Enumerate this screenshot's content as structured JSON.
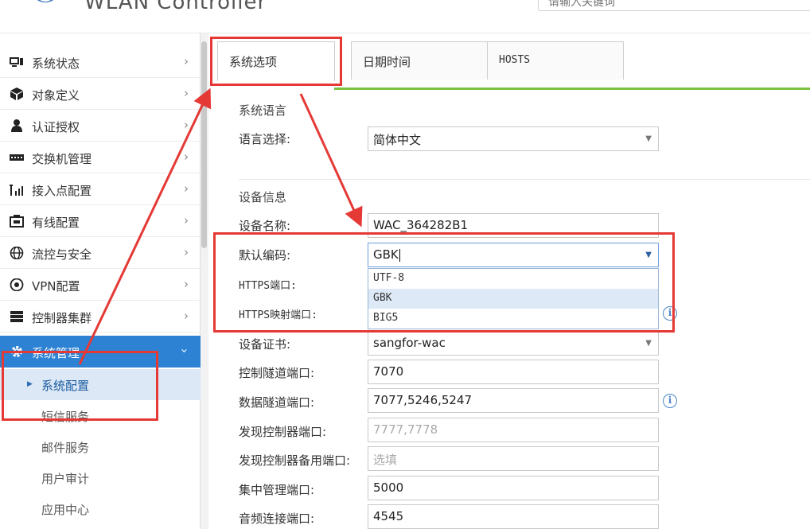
{
  "header": {
    "brand": "WLAN Controller",
    "search_placeholder": "请输入关键词"
  },
  "sidebar": {
    "items": [
      {
        "label": "系统状态",
        "icon": "monitor-icon"
      },
      {
        "label": "对象定义",
        "icon": "cube-icon"
      },
      {
        "label": "认证授权",
        "icon": "user-icon"
      },
      {
        "label": "交换机管理",
        "icon": "switch-icon"
      },
      {
        "label": "接入点配置",
        "icon": "antenna-icon"
      },
      {
        "label": "有线配置",
        "icon": "wired-icon"
      },
      {
        "label": "流控与安全",
        "icon": "globe-icon"
      },
      {
        "label": "VPN配置",
        "icon": "vpn-icon"
      },
      {
        "label": "控制器集群",
        "icon": "cluster-icon"
      },
      {
        "label": "系统管理",
        "icon": "gear-icon"
      }
    ],
    "sub_items": [
      {
        "label": "系统配置"
      },
      {
        "label": "短信服务"
      },
      {
        "label": "邮件服务"
      },
      {
        "label": "用户审计"
      },
      {
        "label": "应用中心"
      }
    ]
  },
  "tabs": [
    {
      "label": "系统选项"
    },
    {
      "label": "日期时间"
    },
    {
      "label": "HOSTS"
    }
  ],
  "language": {
    "section_title": "系统语言",
    "label": "语言选择:",
    "value": "简体中文"
  },
  "device": {
    "section_title": "设备信息",
    "rows": {
      "name": {
        "label": "设备名称:",
        "value": "WAC_364282B1"
      },
      "encoding": {
        "label": "默认编码:",
        "value": "GBK"
      },
      "https_port": {
        "label": "HTTPS端口:"
      },
      "https_map_port": {
        "label": "HTTPS映射端口:"
      },
      "cert": {
        "label": "设备证书:",
        "value": "sangfor-wac"
      },
      "ctrl_tunnel": {
        "label": "控制隧道端口:",
        "value": "7070"
      },
      "data_tunnel": {
        "label": "数据隧道端口:",
        "value": "7077,5246,5247"
      },
      "discover": {
        "label": "发现控制器端口:",
        "placeholder": "7777,7778"
      },
      "discover_backup": {
        "label": "发现控制器备用端口:",
        "placeholder": "选填"
      },
      "central_mgmt": {
        "label": "集中管理端口:",
        "value": "5000"
      },
      "audio": {
        "label": "音频连接端口:",
        "value": "4545"
      }
    },
    "encoding_options": [
      "UTF-8",
      "GBK",
      "BIG5"
    ],
    "info_glyph": "i"
  },
  "colors": {
    "accent": "#2d82d3",
    "tab_rule": "#7ac143",
    "annotation": "#e53935"
  }
}
